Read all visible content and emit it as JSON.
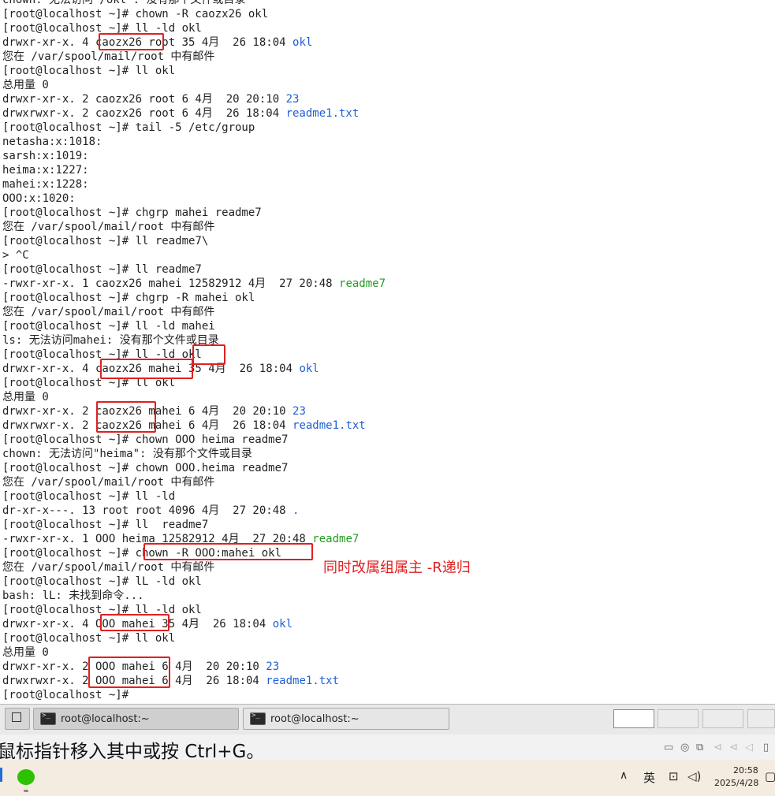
{
  "terminal": {
    "lines": [
      "chown: 无法访问 /okl : 没有那个文件或目录",
      "[root@localhost ~]# chown -R caozx26 okl",
      "[root@localhost ~]# ll -ld okl",
      "drwxr-xr-x. 4 caozx26 root 35 4月  26 18:04 okl",
      "您在 /var/spool/mail/root 中有邮件",
      "[root@localhost ~]# ll okl",
      "总用量 0",
      "drwxr-xr-x. 2 caozx26 root 6 4月  20 20:10 23",
      "drwxrwxr-x. 2 caozx26 root 6 4月  26 18:04 readme1.txt",
      "[root@localhost ~]# tail -5 /etc/group",
      "netasha:x:1018:",
      "sarsh:x:1019:",
      "heima:x:1227:",
      "mahei:x:1228:",
      "OOO:x:1020:",
      "[root@localhost ~]# chgrp mahei readme7",
      "您在 /var/spool/mail/root 中有邮件",
      "[root@localhost ~]# ll readme7\\",
      "> ^C",
      "[root@localhost ~]# ll readme7",
      "-rwxr-xr-x. 1 caozx26 mahei 12582912 4月  27 20:48 readme7",
      "[root@localhost ~]# chgrp -R mahei okl",
      "您在 /var/spool/mail/root 中有邮件",
      "[root@localhost ~]# ll -ld mahei",
      "ls: 无法访问mahei: 没有那个文件或目录",
      "[root@localhost ~]# ll -ld okl",
      "drwxr-xr-x. 4 caozx26 mahei 35 4月  26 18:04 okl",
      "[root@localhost ~]# ll okl",
      "总用量 0",
      "drwxr-xr-x. 2 caozx26 mahei 6 4月  20 20:10 23",
      "drwxrwxr-x. 2 caozx26 mahei 6 4月  26 18:04 readme1.txt",
      "[root@localhost ~]# chown OOO heima readme7",
      "chown: 无法访问\"heima\": 没有那个文件或目录",
      "[root@localhost ~]# chown OOO.heima readme7",
      "您在 /var/spool/mail/root 中有邮件",
      "[root@localhost ~]# ll -ld",
      "dr-xr-x---. 13 root root 4096 4月  27 20:48 .",
      "[root@localhost ~]# ll  readme7",
      "-rwxr-xr-x. 1 OOO heima 12582912 4月  27 20:48 readme7",
      "[root@localhost ~]# chown -R OOO:mahei okl",
      "您在 /var/spool/mail/root 中有邮件",
      "[root@localhost ~]# lL -ld okl",
      "bash: lL: 未找到命令...",
      "[root@localhost ~]# ll -ld okl",
      "drwxr-xr-x. 4 OOO mahei 35 4月  26 18:04 okl",
      "[root@localhost ~]# ll okl",
      "总用量 0",
      "drwxr-xr-x. 2 OOO mahei 6 4月  20 20:10 23",
      "drwxrwxr-x. 2 OOO mahei 6 4月  26 18:04 readme1.txt",
      "[root@localhost ~]# "
    ],
    "colored_names": {
      "3": {
        "text": "okl",
        "color": "blue"
      },
      "7": {
        "text": "23",
        "color": "blue"
      },
      "8": {
        "text": "readme1.txt",
        "color": "blue"
      },
      "20": {
        "text": "readme7",
        "color": "green"
      },
      "26": {
        "text": "okl",
        "color": "blue"
      },
      "29": {
        "text": "23",
        "color": "blue"
      },
      "30": {
        "text": "readme1.txt",
        "color": "blue"
      },
      "36": {
        "text": ".",
        "color": "blue"
      },
      "38": {
        "text": "readme7",
        "color": "green"
      },
      "44": {
        "text": "okl",
        "color": "blue"
      },
      "47": {
        "text": "23",
        "color": "blue"
      },
      "48": {
        "text": "readme1.txt",
        "color": "blue"
      }
    },
    "annotation": "同时改属组属主 -R递归",
    "highlight_color": "#e02020",
    "file_color_blue": "#1e5fd6",
    "file_color_green": "#1f9e1f"
  },
  "taskbar": {
    "restore_icon": "restore-windows-icon",
    "windows": [
      {
        "label": "root@localhost:~",
        "icon": "terminal-icon",
        "active": true
      },
      {
        "label": "root@localhost:~",
        "icon": "terminal-icon",
        "active": false
      }
    ]
  },
  "hint": {
    "text": "鼠标指针移入其中或按 Ctrl+G。"
  },
  "system_tray": {
    "ime": "英",
    "time": "20:58",
    "date": "2025/4/28"
  }
}
